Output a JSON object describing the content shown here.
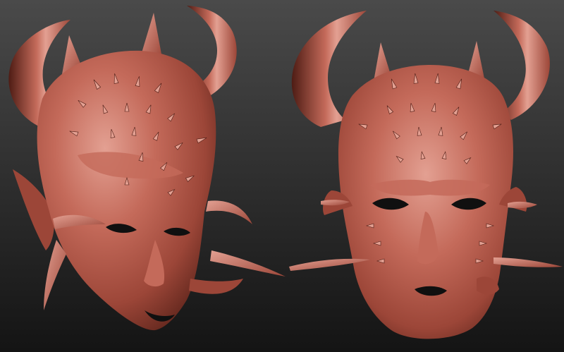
{
  "scene": {
    "background_top": "#4a4a4a",
    "background_bottom": "#141414",
    "material_light": "#c46a5a",
    "material_mid": "#9c4638",
    "material_shadow": "#4e1c14",
    "material_highlight": "#e3a092"
  },
  "models": [
    {
      "name": "demon-mask",
      "view": "three-quarter"
    },
    {
      "name": "demon-mask",
      "view": "front"
    }
  ]
}
